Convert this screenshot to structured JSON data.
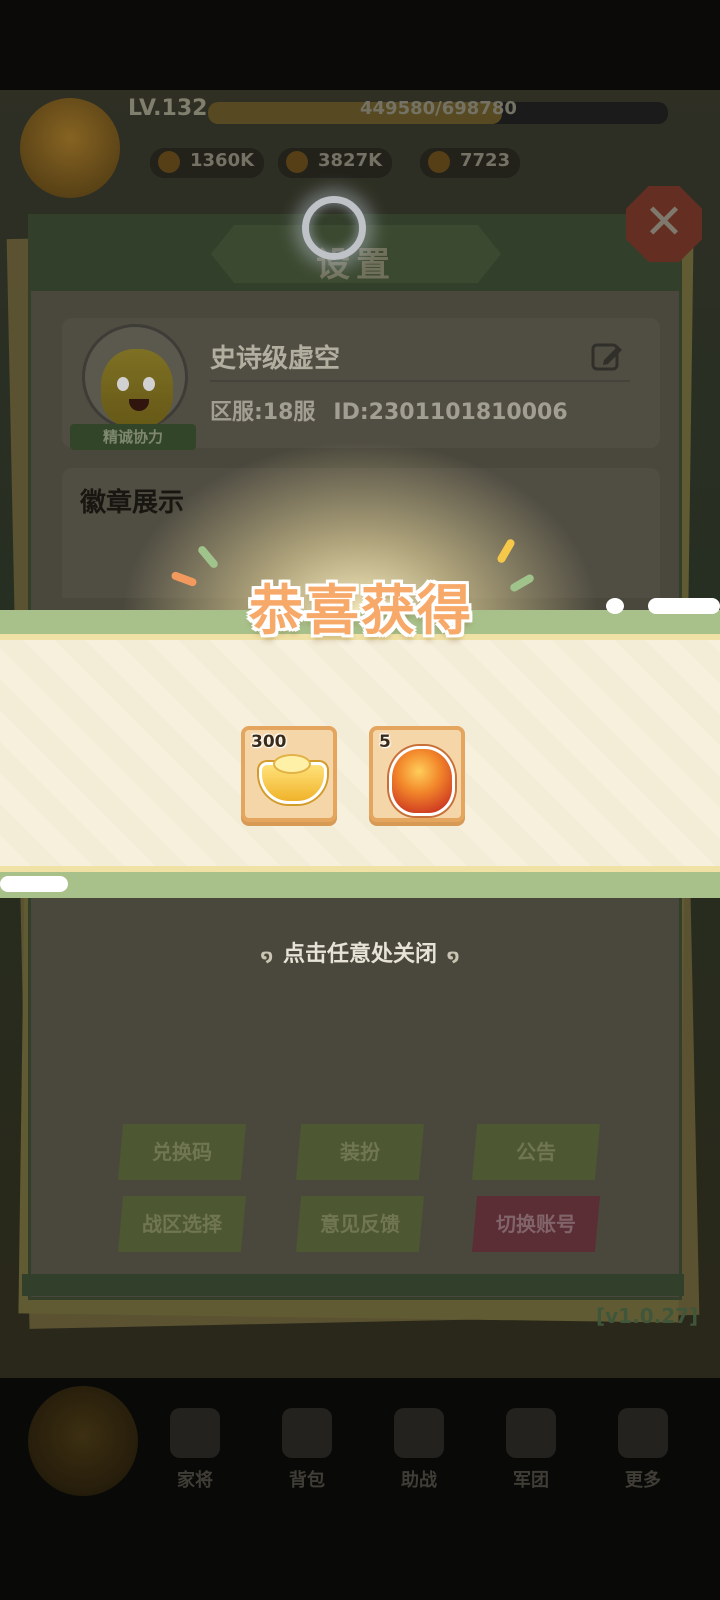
{
  "player": {
    "level": "LV.132",
    "xp": "449580/698780",
    "xp_fraction": 0.64,
    "resources": [
      "1360K",
      "3827K",
      "7723"
    ]
  },
  "settings": {
    "title": "设置",
    "profile": {
      "name": "史诗级虚空",
      "avatar_tag": "精诚协力",
      "server": "区服:18服",
      "id": "ID:2301101810006"
    },
    "badge_title": "徽章展示",
    "buttons": {
      "redeem_code": "兑换码",
      "dress_up": "装扮",
      "announcement": "公告",
      "server_select": "战区选择",
      "feedback": "意见反馈",
      "switch_account": "切换账号"
    },
    "version": "[v1.0.27]"
  },
  "reward": {
    "title": "恭喜获得",
    "items": [
      {
        "icon": "gold-ingot-icon",
        "count": "300"
      },
      {
        "icon": "fire-stone-icon",
        "count": "5"
      }
    ],
    "close_hint": "点击任意处关闭"
  },
  "bottom_nav": [
    "家将",
    "背包",
    "助战",
    "军团",
    "更多"
  ],
  "colors": {
    "reward_title": "#f7a96a",
    "band_green": "#a8c08a",
    "band_bg": "#f6f0dd",
    "switch_account_red": "#703740"
  }
}
